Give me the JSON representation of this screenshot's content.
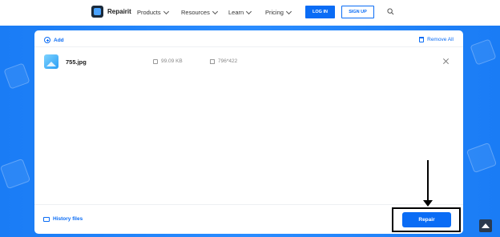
{
  "nav": {
    "brand": "Repairit",
    "menu": [
      "Products",
      "Resources",
      "Learn",
      "Pricing"
    ],
    "login": "LOG IN",
    "signup": "SIGN UP"
  },
  "toolbar": {
    "add": "Add",
    "remove_all": "Remove All"
  },
  "file": {
    "name": "755.jpg",
    "size": "99.09 KB",
    "dimensions": "796*422"
  },
  "footer": {
    "history": "History files",
    "repair": "Repair"
  },
  "colors": {
    "accent": "#0a6cf5",
    "background": "#1a7cf5"
  }
}
